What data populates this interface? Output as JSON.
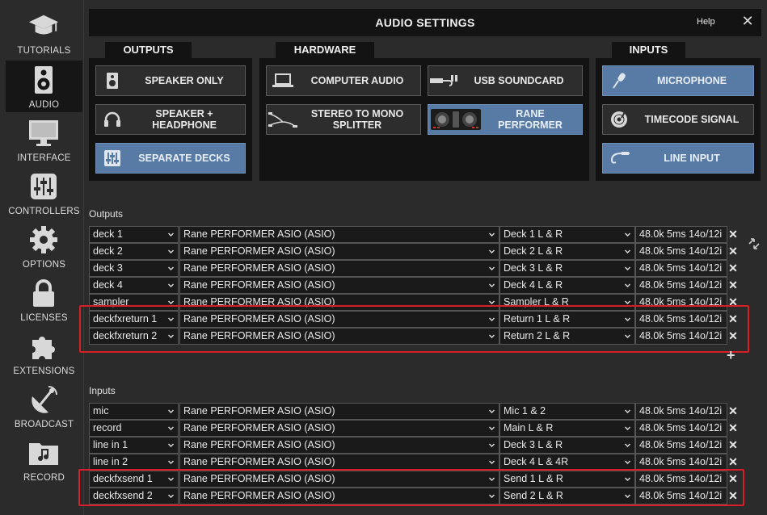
{
  "sidebar": {
    "items": [
      {
        "label": "TUTORIALS",
        "icon": "graduation-cap-icon"
      },
      {
        "label": "AUDIO",
        "icon": "speaker-icon"
      },
      {
        "label": "INTERFACE",
        "icon": "monitor-icon"
      },
      {
        "label": "CONTROLLERS",
        "icon": "sliders-icon"
      },
      {
        "label": "OPTIONS",
        "icon": "gear-icon"
      },
      {
        "label": "LICENSES",
        "icon": "lock-icon"
      },
      {
        "label": "EXTENSIONS",
        "icon": "puzzle-icon"
      },
      {
        "label": "BROADCAST",
        "icon": "satellite-dish-icon"
      },
      {
        "label": "RECORD",
        "icon": "music-folder-icon"
      }
    ],
    "active": "AUDIO"
  },
  "header": {
    "title": "AUDIO SETTINGS",
    "help": "Help",
    "close": "✕"
  },
  "outputs_group": {
    "tab": "OUTPUTS",
    "buttons": [
      {
        "label": "SPEAKER ONLY",
        "icon": "speaker-icon",
        "selected": false
      },
      {
        "label": "SPEAKER + HEADPHONE",
        "icon": "headphone-icon",
        "selected": false
      },
      {
        "label": "SEPARATE DECKS",
        "icon": "mixer-icon",
        "selected": true
      }
    ]
  },
  "hardware_group": {
    "tab": "HARDWARE",
    "buttons": [
      {
        "label": "COMPUTER AUDIO",
        "icon": "laptop-icon",
        "selected": false
      },
      {
        "label": "USB SOUNDCARD",
        "icon": "usb-soundcard-icon",
        "selected": false
      },
      {
        "label": "STEREO TO MONO SPLITTER",
        "icon": "splitter-cable-icon",
        "selected": false
      },
      {
        "label": "RANE PERFORMER",
        "icon": "dj-controller-icon",
        "selected": true
      }
    ]
  },
  "inputs_group": {
    "tab": "INPUTS",
    "buttons": [
      {
        "label": "MICROPHONE",
        "icon": "microphone-icon",
        "selected": true
      },
      {
        "label": "TIMECODE SIGNAL",
        "icon": "vinyl-icon",
        "selected": false
      },
      {
        "label": "LINE INPUT",
        "icon": "cable-icon",
        "selected": true
      }
    ]
  },
  "outputs": {
    "label": "Outputs",
    "rows": [
      {
        "name": "deck 1",
        "device": "Rane PERFORMER ASIO (ASIO)",
        "channel": "Deck 1 L & R",
        "info": "48.0k 5ms 14o/12i"
      },
      {
        "name": "deck 2",
        "device": "Rane PERFORMER ASIO (ASIO)",
        "channel": "Deck 2 L & R",
        "info": "48.0k 5ms 14o/12i"
      },
      {
        "name": "deck 3",
        "device": "Rane PERFORMER ASIO (ASIO)",
        "channel": "Deck 3 L & R",
        "info": "48.0k 5ms 14o/12i"
      },
      {
        "name": "deck 4",
        "device": "Rane PERFORMER ASIO (ASIO)",
        "channel": "Deck 4 L & R",
        "info": "48.0k 5ms 14o/12i"
      },
      {
        "name": "sampler",
        "device": "Rane PERFORMER ASIO (ASIO)",
        "channel": "Sampler L & R",
        "info": "48.0k 5ms 14o/12i"
      },
      {
        "name": "deckfxreturn 1",
        "device": "Rane PERFORMER ASIO (ASIO)",
        "channel": "Return 1 L & R",
        "info": "48.0k 5ms 14o/12i"
      },
      {
        "name": "deckfxreturn 2",
        "device": "Rane PERFORMER ASIO (ASIO)",
        "channel": "Return 2 L & R",
        "info": "48.0k 5ms 14o/12i"
      }
    ]
  },
  "inputs": {
    "label": "Inputs",
    "rows": [
      {
        "name": "mic",
        "device": "Rane PERFORMER ASIO (ASIO)",
        "channel": "Mic 1 & 2",
        "info": "48.0k 5ms 14o/12i"
      },
      {
        "name": "record",
        "device": "Rane PERFORMER ASIO (ASIO)",
        "channel": "Main L & R",
        "info": "48.0k 5ms 14o/12i"
      },
      {
        "name": "line in 1",
        "device": "Rane PERFORMER ASIO (ASIO)",
        "channel": "Deck 3 L & R",
        "info": "48.0k 5ms 14o/12i"
      },
      {
        "name": "line in 2",
        "device": "Rane PERFORMER ASIO (ASIO)",
        "channel": "Deck 4 L & 4R",
        "info": "48.0k 5ms 14o/12i"
      },
      {
        "name": "deckfxsend 1",
        "device": "Rane PERFORMER ASIO (ASIO)",
        "channel": "Send 1 L & R",
        "info": "48.0k 5ms 14o/12i"
      },
      {
        "name": "deckfxsend 2",
        "device": "Rane PERFORMER ASIO (ASIO)",
        "channel": "Send 2 L & R",
        "info": "48.0k 5ms 14o/12i"
      }
    ]
  },
  "remove_symbol": "✕",
  "add_symbol": "+",
  "colors": {
    "selected": "#587ba6",
    "highlight": "#d61f26",
    "panel": "#131313"
  }
}
